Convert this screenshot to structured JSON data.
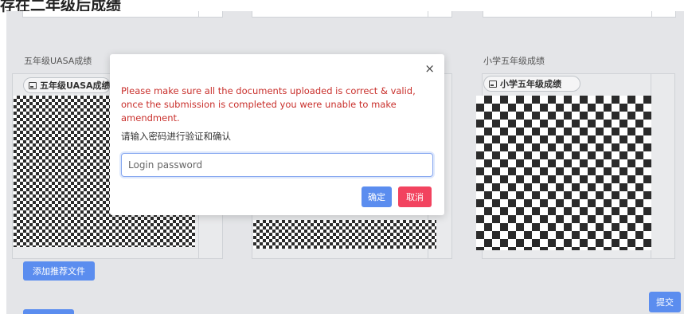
{
  "page": {
    "heading": "存在二年级后成绩"
  },
  "sections": [
    {
      "label": "五年级UASA成绩",
      "tag": "五年级UASA成绩"
    },
    {
      "label": "小学五年级成绩",
      "tag": "小学五年级成绩"
    }
  ],
  "buttons": {
    "add_recommend": "添加推荐文件",
    "submit": "提交"
  },
  "modal": {
    "close": "×",
    "warning": "Please make sure all the documents uploaded is correct & valid, once the submission is completed you were unable to make amendment.",
    "hint": "请输入密码进行验证和确认",
    "password_placeholder": "Login password",
    "password_value": "",
    "confirm": "确定",
    "cancel": "取消"
  },
  "colors": {
    "primary": "#5b8def",
    "danger": "#f2435f",
    "warning_text": "#c9302c"
  }
}
